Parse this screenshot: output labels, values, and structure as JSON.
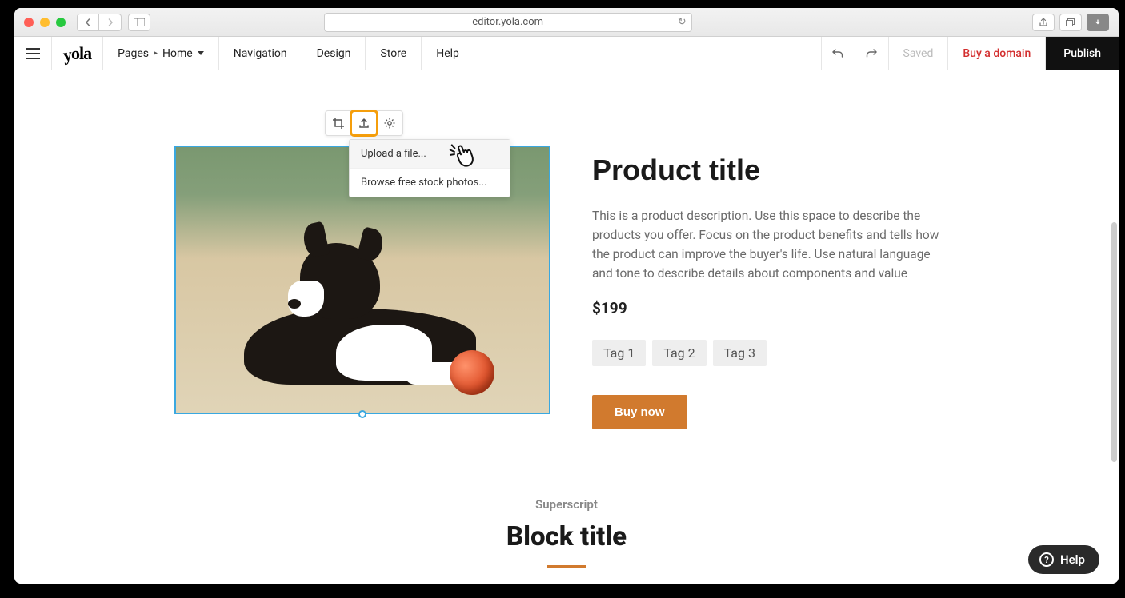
{
  "browser": {
    "url": "editor.yola.com"
  },
  "toolbar": {
    "pages_label": "Pages",
    "current_page": "Home",
    "navigation": "Navigation",
    "design": "Design",
    "store": "Store",
    "help": "Help",
    "saved": "Saved",
    "buy_domain": "Buy a domain",
    "publish": "Publish"
  },
  "image_menu": {
    "upload": "Upload a file...",
    "browse": "Browse free stock photos..."
  },
  "product": {
    "title": "Product title",
    "description": "This is a product description. Use this space to describe the products you offer. Focus on the product benefits and tells how the product can improve the buyer's life. Use natural language and tone to describe details about components and value",
    "price": "$199",
    "tags": [
      "Tag 1",
      "Tag 2",
      "Tag 3"
    ],
    "buy_label": "Buy now"
  },
  "next_block": {
    "superscript": "Superscript",
    "title": "Block title"
  },
  "help_widget": {
    "label": "Help"
  }
}
